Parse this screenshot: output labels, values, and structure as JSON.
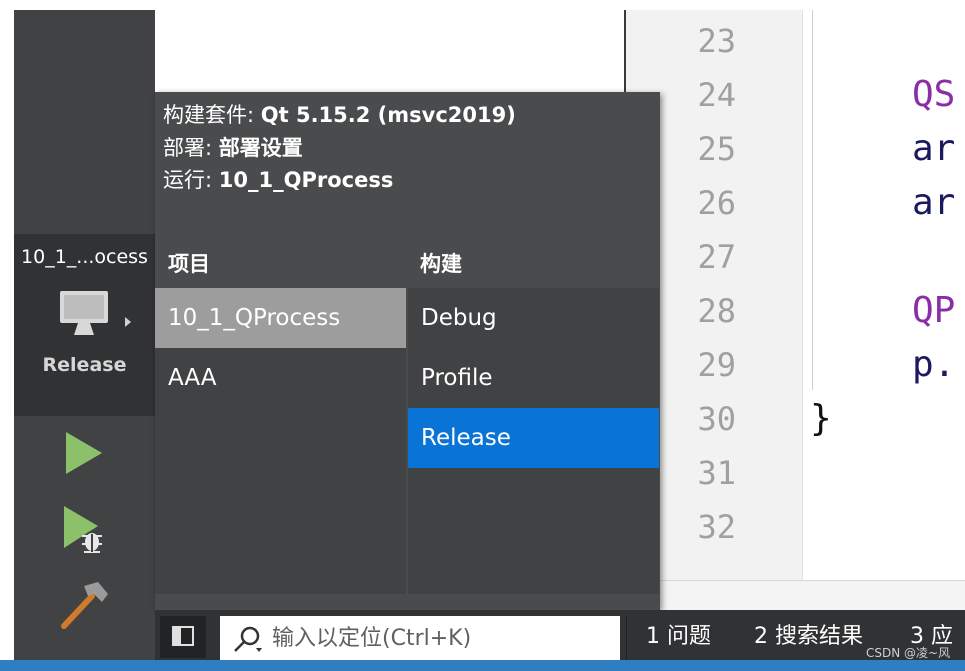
{
  "sidebar": {
    "kit": {
      "name": "10_1_...ocess",
      "build": "Release",
      "icon": "monitor-icon"
    },
    "actions": [
      {
        "icon": "run-icon",
        "color": "#8cc06a"
      },
      {
        "icon": "debug-run-icon",
        "color": "#8cc06a"
      },
      {
        "icon": "hammer-build-icon",
        "color": "#d07a2a"
      }
    ]
  },
  "popup": {
    "kit_label": "构建套件:",
    "kit_value": "Qt 5.15.2 (msvc2019)",
    "deploy_label": "部署:",
    "deploy_value": "部署设置",
    "run_label": "运行:",
    "run_value": "10_1_QProcess",
    "projects_header": "项目",
    "builds_header": "构建",
    "projects": [
      {
        "label": "10_1_QProcess",
        "selected": true
      },
      {
        "label": "AAA",
        "selected": false
      }
    ],
    "builds": [
      {
        "label": "Debug",
        "selected": false
      },
      {
        "label": "Profile",
        "selected": false
      },
      {
        "label": "Release",
        "selected": true
      }
    ],
    "selected_color": "#0a74d6"
  },
  "editor": {
    "line_numbers": [
      "23",
      "24",
      "25",
      "26",
      "27",
      "28",
      "29",
      "30",
      "31",
      "32"
    ],
    "code": {
      "line24": "QS",
      "line25": "ar",
      "line26": "ar",
      "line28": "QP",
      "line29": "p.",
      "line30": "}"
    }
  },
  "bottombar": {
    "locator_placeholder": "输入以定位(Ctrl+K)",
    "tabs": [
      {
        "num": "1",
        "label": "问题"
      },
      {
        "num": "2",
        "label": "搜索结果"
      },
      {
        "num": "3",
        "label": "应"
      }
    ]
  },
  "watermark": "CSDN @凌~风"
}
